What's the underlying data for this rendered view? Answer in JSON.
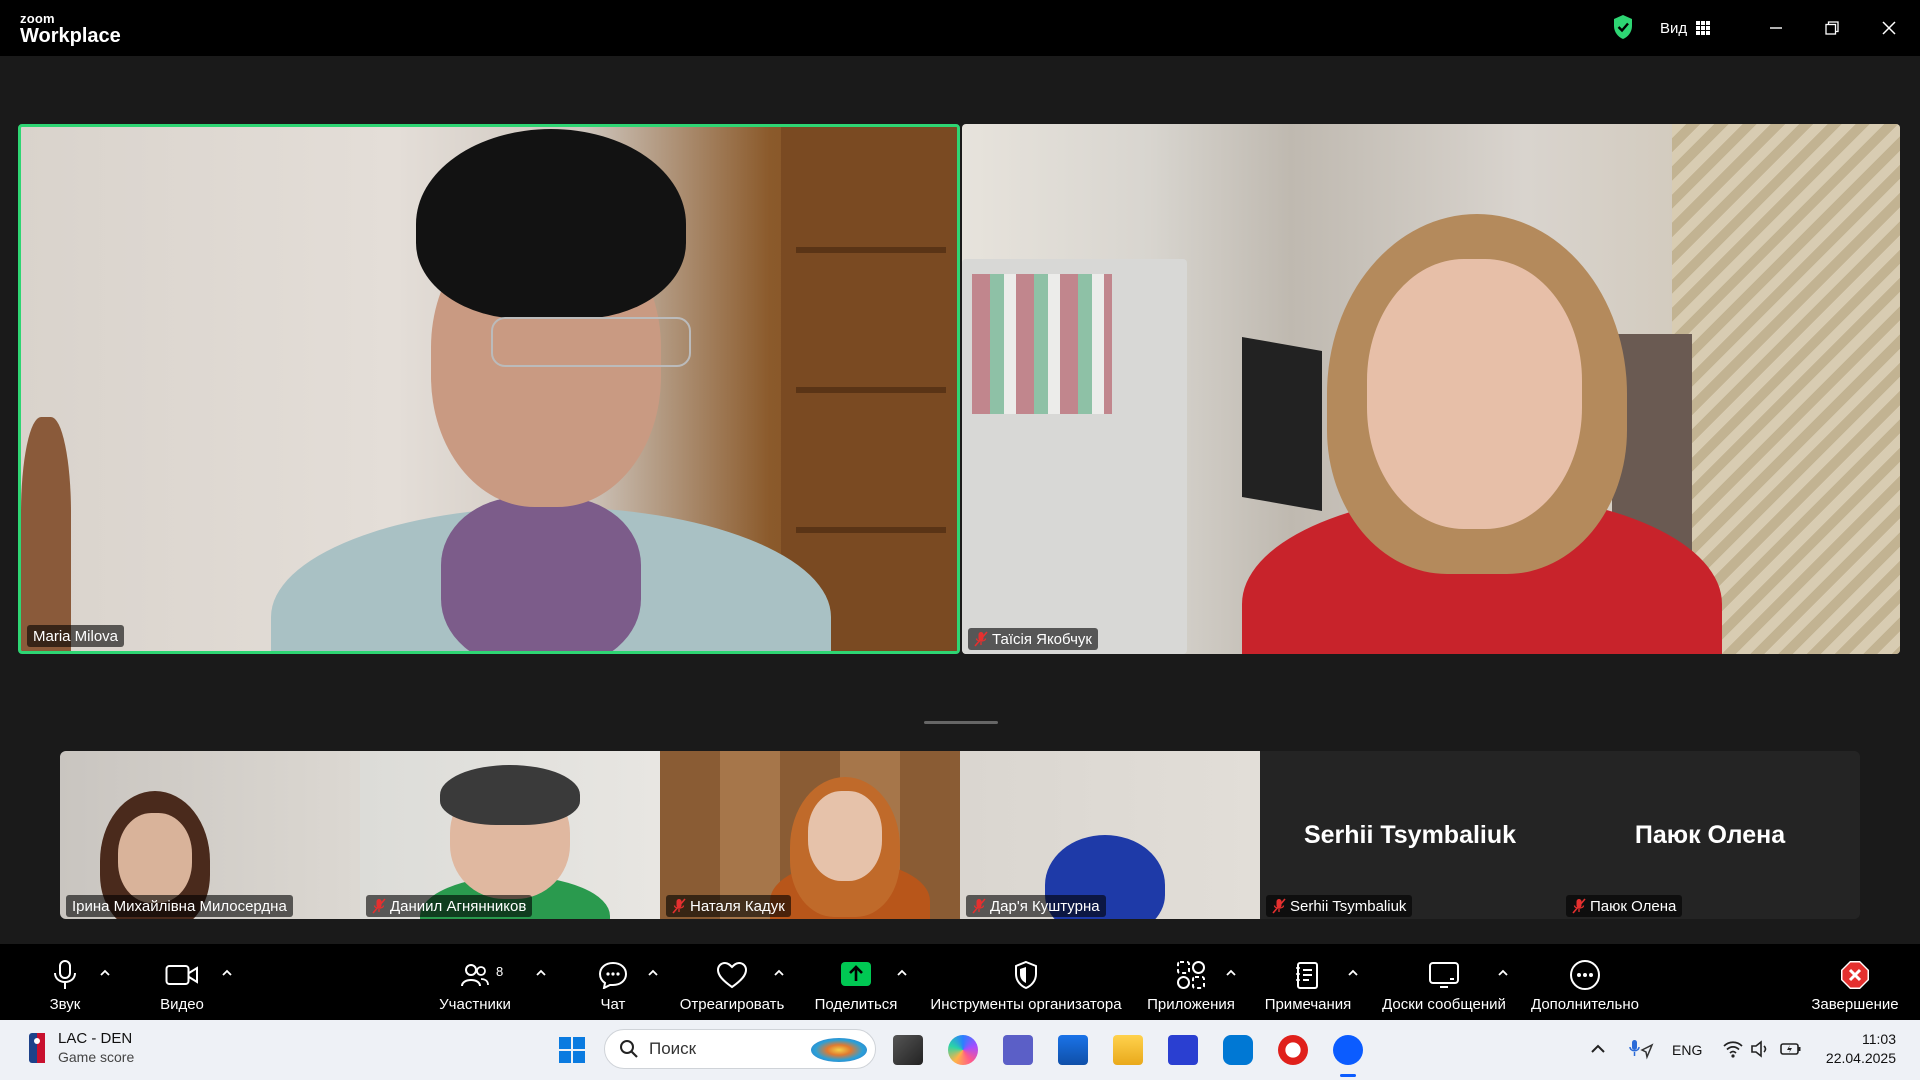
{
  "app": {
    "brand_small": "zoom",
    "brand_large": "Workplace",
    "view_label": "Вид"
  },
  "main_tiles": [
    {
      "name": "Maria Milova",
      "muted": false,
      "active_speaker": true
    },
    {
      "name": "Таїсія Якобчук",
      "muted": true,
      "active_speaker": false
    }
  ],
  "strip_tiles": [
    {
      "name": "Ірина Михайлівна Милосердна",
      "muted": false,
      "video": true
    },
    {
      "name": "Даниил Агнянников",
      "muted": true,
      "video": true
    },
    {
      "name": "Наталя Кадук",
      "muted": true,
      "video": true
    },
    {
      "name": "Дар'я Куштурна",
      "muted": true,
      "video": true
    },
    {
      "name": "Serhii Tsymbaliuk",
      "display_name": "Serhii Tsymbaliuk",
      "muted": true,
      "video": false
    },
    {
      "name": "Паюк Олена",
      "display_name": "Паюк Олена",
      "muted": true,
      "video": false
    }
  ],
  "toolbar": {
    "audio": "Звук",
    "video": "Видео",
    "participants": "Участники",
    "participants_count": "8",
    "chat": "Чат",
    "react": "Отреагировать",
    "share": "Поделиться",
    "host_tools": "Инструменты организатора",
    "apps": "Приложения",
    "notes": "Примечания",
    "whiteboards": "Доски сообщений",
    "more": "Дополнительно",
    "end": "Завершение"
  },
  "taskbar": {
    "news_title": "LAC - DEN",
    "news_subtitle": "Game score",
    "search_placeholder": "Поиск",
    "lang": "ENG",
    "time": "11:03",
    "date": "22.04.2025"
  },
  "colors": {
    "active_speaker_border": "#2ed573",
    "share_green": "#00c853",
    "end_red": "#e5302f"
  }
}
